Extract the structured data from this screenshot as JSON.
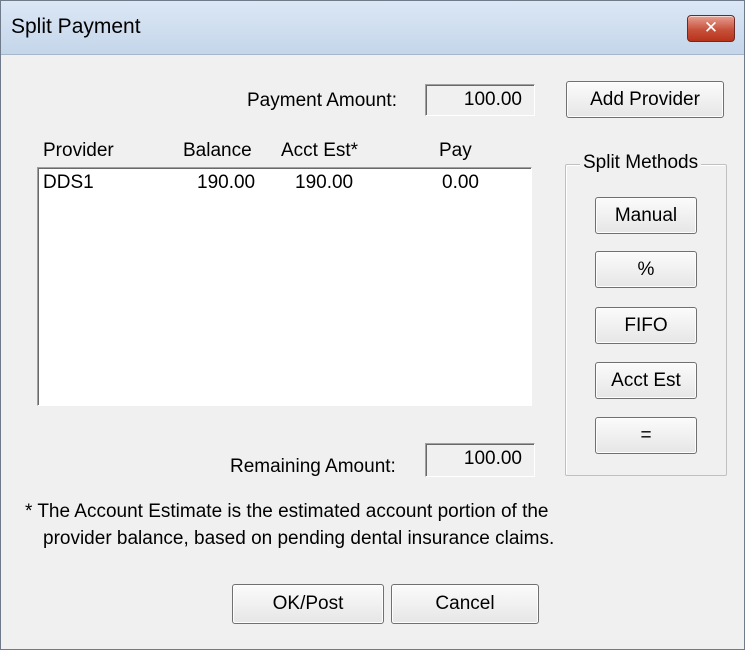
{
  "window": {
    "title": "Split Payment",
    "close_glyph": "✕"
  },
  "payment": {
    "label": "Payment Amount:",
    "value": "100.00"
  },
  "add_provider_label": "Add Provider",
  "list": {
    "headers": [
      "Provider",
      "Balance",
      "Acct Est*",
      "Pay"
    ],
    "rows": [
      {
        "provider": "DDS1",
        "balance": "190.00",
        "acct_est": "190.00",
        "pay": "0.00"
      }
    ]
  },
  "split_methods": {
    "legend": "Split Methods",
    "buttons": [
      "Manual",
      "%",
      "FIFO",
      "Acct Est",
      "="
    ]
  },
  "remaining": {
    "label": "Remaining Amount:",
    "value": "100.00"
  },
  "note": {
    "line1": "* The Account Estimate is the estimated account portion of the",
    "line2": "provider balance, based on pending dental insurance claims."
  },
  "footer": {
    "ok_label": "OK/Post",
    "cancel_label": "Cancel"
  }
}
